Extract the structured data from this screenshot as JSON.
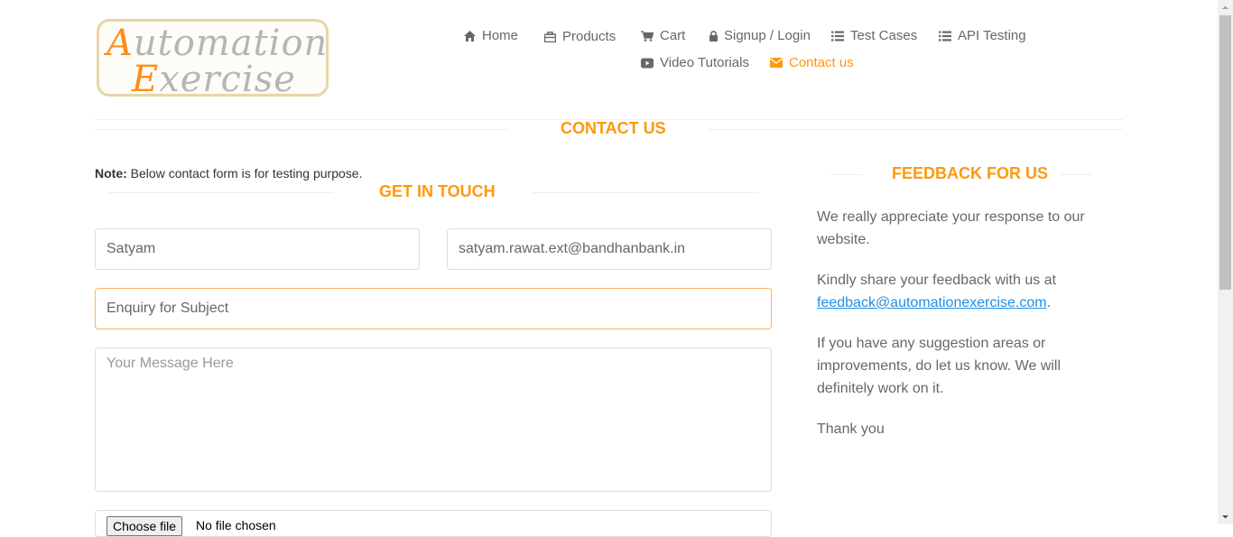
{
  "logo": {
    "line1_cap": "A",
    "line1_rest": "utomation",
    "line2_cap": "E",
    "line2_rest": "xercise"
  },
  "nav": [
    {
      "label": "Home",
      "icon": "home-icon"
    },
    {
      "label": "Products",
      "icon": "briefcase-icon"
    },
    {
      "label": "Cart",
      "icon": "cart-icon"
    },
    {
      "label": "Signup / Login",
      "icon": "lock-icon"
    },
    {
      "label": "Test Cases",
      "icon": "list-icon"
    },
    {
      "label": "API Testing",
      "icon": "list-icon"
    },
    {
      "label": "Video Tutorials",
      "icon": "youtube-play-icon"
    },
    {
      "label": "Contact us",
      "icon": "envelope-icon",
      "active": true
    }
  ],
  "page_title": "Contact Us",
  "note": {
    "label": "Note:",
    "text": "Below contact form is for testing purpose."
  },
  "form": {
    "title": "Get In Touch",
    "name_value": "Satyam",
    "email_value": "satyam.rawat.ext@bandhanbank.in",
    "subject_value": "Enquiry for Subject",
    "message_placeholder": "Your Message Here",
    "file_button": "Choose file",
    "file_status": "No file chosen"
  },
  "feedback": {
    "title": "Feedback For Us",
    "p1": "We really appreciate your response to our website.",
    "p2_prefix": "Kindly share your feedback with us at",
    "p2_email": "feedback@automationexercise.com",
    "p2_suffix": ".",
    "p3": "If you have any suggestion areas or improvements, do let us know. We will definitely work on it.",
    "p4": "Thank you"
  },
  "colors": {
    "accent": "#fe980f",
    "text": "#696763",
    "link": "#1f8fe6"
  }
}
